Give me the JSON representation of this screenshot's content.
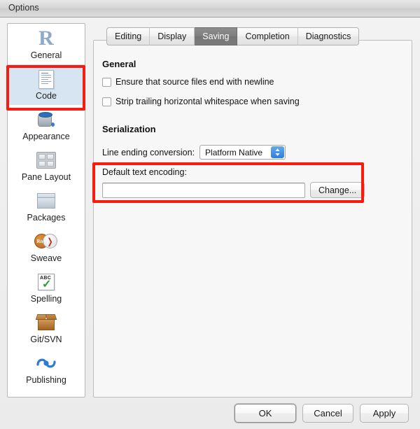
{
  "window": {
    "title": "Options"
  },
  "sidebar": {
    "items": [
      {
        "label": "General",
        "icon": "r-logo-icon",
        "selected": false
      },
      {
        "label": "Code",
        "icon": "code-document-icon",
        "selected": true
      },
      {
        "label": "Appearance",
        "icon": "paint-can-icon",
        "selected": false
      },
      {
        "label": "Pane Layout",
        "icon": "pane-grid-icon",
        "selected": false
      },
      {
        "label": "Packages",
        "icon": "package-box-icon",
        "selected": false
      },
      {
        "label": "Sweave",
        "icon": "sweave-rnw-pdf-icon",
        "selected": false
      },
      {
        "label": "Spelling",
        "icon": "spelling-abc-check-icon",
        "selected": false
      },
      {
        "label": "Git/SVN",
        "icon": "git-box-icon",
        "selected": false
      },
      {
        "label": "Publishing",
        "icon": "publishing-icon",
        "selected": false
      }
    ]
  },
  "tabs": [
    {
      "label": "Editing",
      "active": false
    },
    {
      "label": "Display",
      "active": false
    },
    {
      "label": "Saving",
      "active": true
    },
    {
      "label": "Completion",
      "active": false
    },
    {
      "label": "Diagnostics",
      "active": false
    }
  ],
  "saving_panel": {
    "general_heading": "General",
    "checkboxes": [
      {
        "label": "Ensure that source files end with newline",
        "checked": false
      },
      {
        "label": "Strip trailing horizontal whitespace when saving",
        "checked": false
      }
    ],
    "serialization_heading": "Serialization",
    "line_ending": {
      "label": "Line ending conversion:",
      "value": "Platform Native"
    },
    "default_encoding": {
      "label": "Default text encoding:",
      "value": "",
      "placeholder": "",
      "change_button": "Change..."
    }
  },
  "footer": {
    "ok": "OK",
    "cancel": "Cancel",
    "apply": "Apply"
  },
  "annotations": {
    "color": "#f61c10",
    "regions": [
      "code-sidebar-item",
      "default-text-encoding-group"
    ]
  }
}
